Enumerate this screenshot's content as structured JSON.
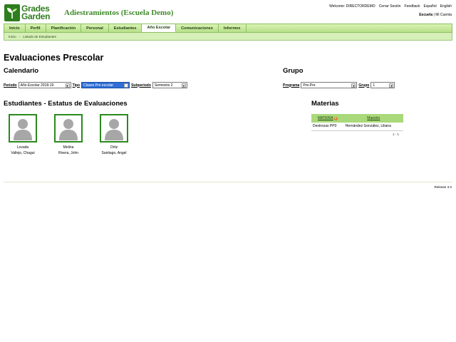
{
  "brand": {
    "line1": "Grades",
    "line2": "Garden",
    "accent": "#2e7d1e"
  },
  "header": {
    "school": "Adiestramientos (Escuela Demo)",
    "links": [
      "Welcome: DIRECTORDEMO",
      "Cerrar Sesión",
      "Feedback",
      "Español",
      "English"
    ],
    "scope_active": "Escuela",
    "scope_sep": " | ",
    "scope_other": "Mi Cuenta"
  },
  "nav": {
    "tabs": [
      "Inicio",
      "Perfil",
      "Planificación",
      "Personal",
      "Estudiantes",
      "Año Escolar",
      "Comunicaciones",
      "Informes"
    ],
    "active": "Año Escolar"
  },
  "breadcrumb": [
    "Inicio",
    "Listado de Estudiantes"
  ],
  "page_title": "Evaluaciones Prescolar",
  "calendario": {
    "title": "Calendario",
    "periodo_label": "Periodo",
    "periodo_value": "Año Escolar 2018-19",
    "tipo_label": "Tipo",
    "tipo_value": "Clases Pre escolar",
    "subperiodo_label": "Subperiodo",
    "subperiodo_value": "Semestre 2"
  },
  "grupo": {
    "title": "Grupo",
    "programa_label": "Programa",
    "programa_value": "Pre-Pre",
    "grupo_label": "Grupo",
    "grupo_value": "1"
  },
  "students_section": {
    "title": "Estudiantes - Estatus de Evaluaciones",
    "students": [
      {
        "first": "Lozada",
        "second": "Vallejo, Chagui"
      },
      {
        "first": "Molina",
        "second": "Rivera, John"
      },
      {
        "first": "Ortiz",
        "second": "Santiago, Angel"
      }
    ]
  },
  "materias": {
    "title": "Materias",
    "col_materia": "MATERIA",
    "col_maestro": "Maestro",
    "rows": [
      {
        "materia": "Destrezas PP0",
        "maestro": "Hernández González, Liliana"
      }
    ],
    "pager": "1 - 1"
  },
  "footer": {
    "release": "Release 3.3"
  }
}
